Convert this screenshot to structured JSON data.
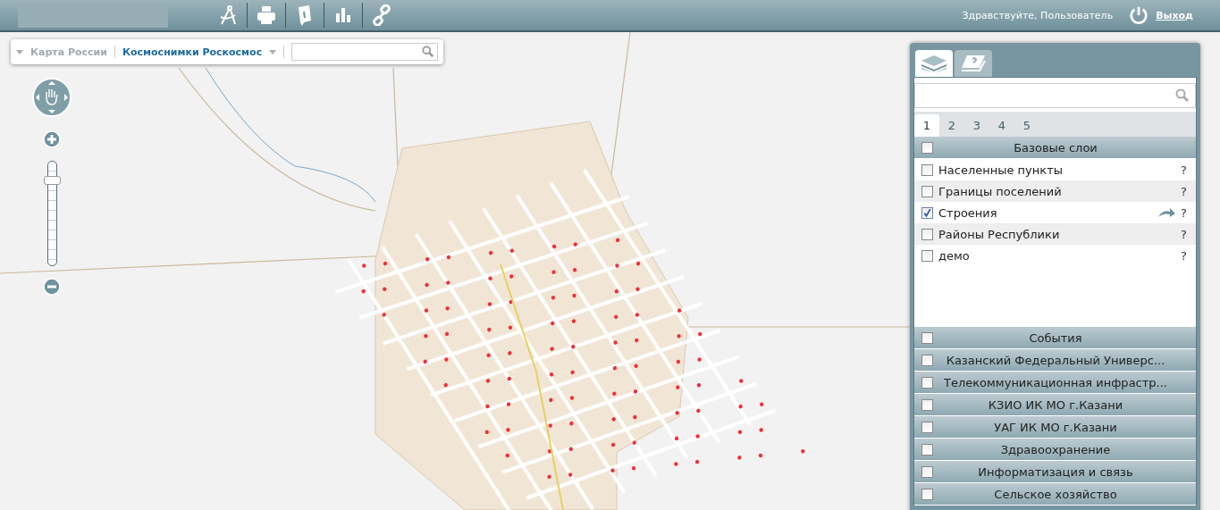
{
  "top_bar": {
    "greeting": "Здравствуйте, Пользователь",
    "logout": "Выход"
  },
  "basemaps": [
    {
      "label": "Карта России",
      "selected": false
    },
    {
      "label": "Космоснимки Роскосмос",
      "selected": true
    }
  ],
  "zoom": {
    "level": 0.83
  },
  "panel": {
    "tabs": [
      {
        "kind": "layers",
        "selected": true
      },
      {
        "kind": "legend",
        "selected": false
      }
    ],
    "pages": [
      {
        "label": "1",
        "selected": true
      },
      {
        "label": "2",
        "selected": false
      },
      {
        "label": "3",
        "selected": false
      },
      {
        "label": "4",
        "selected": false
      },
      {
        "label": "5",
        "selected": false
      }
    ],
    "groups": [
      {
        "title": "Базовые слои",
        "checked": false,
        "layers": [
          {
            "name": "Населенные пункты",
            "checked": false,
            "style_arrow": false,
            "help": "?"
          },
          {
            "name": "Границы поселений",
            "checked": false,
            "style_arrow": false,
            "help": "?"
          },
          {
            "name": "Строения",
            "checked": true,
            "style_arrow": true,
            "help": "?"
          },
          {
            "name": "Районы Республики",
            "checked": false,
            "style_arrow": false,
            "help": "?"
          },
          {
            "name": "демо",
            "checked": false,
            "style_arrow": false,
            "help": "?"
          }
        ]
      },
      {
        "title": "События",
        "checked": false
      },
      {
        "title": "Казанский Федеральный Универс...",
        "checked": false
      },
      {
        "title": "Телекоммуникационная инфрастр...",
        "checked": false
      },
      {
        "title": "КЗИО ИК МО г.Казани",
        "checked": false
      },
      {
        "title": "УАГ ИК МО г.Казани",
        "checked": false
      },
      {
        "title": "Здравоохранение",
        "checked": false
      },
      {
        "title": "Информатизация и связь",
        "checked": false
      },
      {
        "title": "Сельское хозяйство",
        "checked": false
      }
    ]
  }
}
